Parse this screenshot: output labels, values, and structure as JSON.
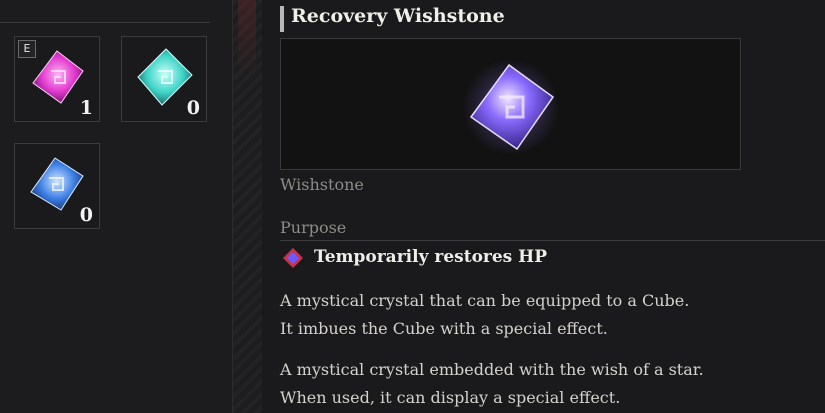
{
  "inventory": {
    "slots": [
      {
        "name": "pink-wishstone",
        "badge": "E",
        "count": "1",
        "color": "#e23ad0"
      },
      {
        "name": "cyan-wishstone",
        "badge": "",
        "count": "0",
        "color": "#3fd3c7"
      },
      {
        "name": "blue-wishstone",
        "badge": "",
        "count": "0",
        "color": "#3d7fe6"
      }
    ]
  },
  "detail": {
    "title": "Recovery Wishstone",
    "type": "Wishstone",
    "purpose_label": "Purpose",
    "effect": "Temporarily restores HP",
    "description1_line1": "A mystical crystal that can be equipped to a Cube.",
    "description1_line2": "It imbues the Cube with a special effect.",
    "description2_line1": "A mystical crystal embedded with the wish of a star.",
    "description2_line2": "When used, it can display a special effect.",
    "gem_color": "#7a5cff",
    "effect_icon_color": "#c8324a"
  }
}
